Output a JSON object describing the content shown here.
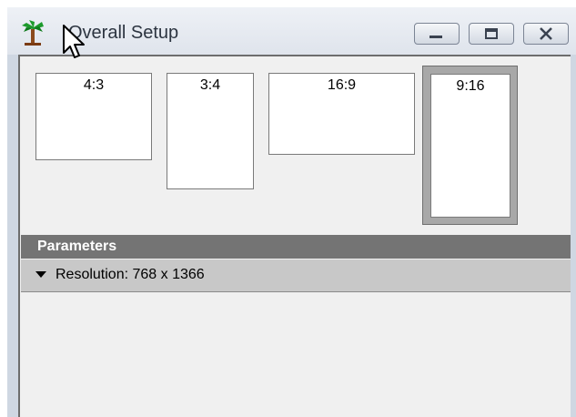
{
  "window": {
    "title": "Overall Setup",
    "app_icon": "palm-tree-icon",
    "controls": [
      "minimize-icon",
      "maximize-icon",
      "close-icon"
    ]
  },
  "aspect_ratios": [
    {
      "label": "4:3",
      "selected": false
    },
    {
      "label": "3:4",
      "selected": false
    },
    {
      "label": "16:9",
      "selected": false
    },
    {
      "label": "9:16",
      "selected": true
    }
  ],
  "parameters": {
    "title": "Parameters",
    "items": [
      {
        "label": "Resolution: 768 x 1366",
        "expanded": true
      }
    ]
  }
}
